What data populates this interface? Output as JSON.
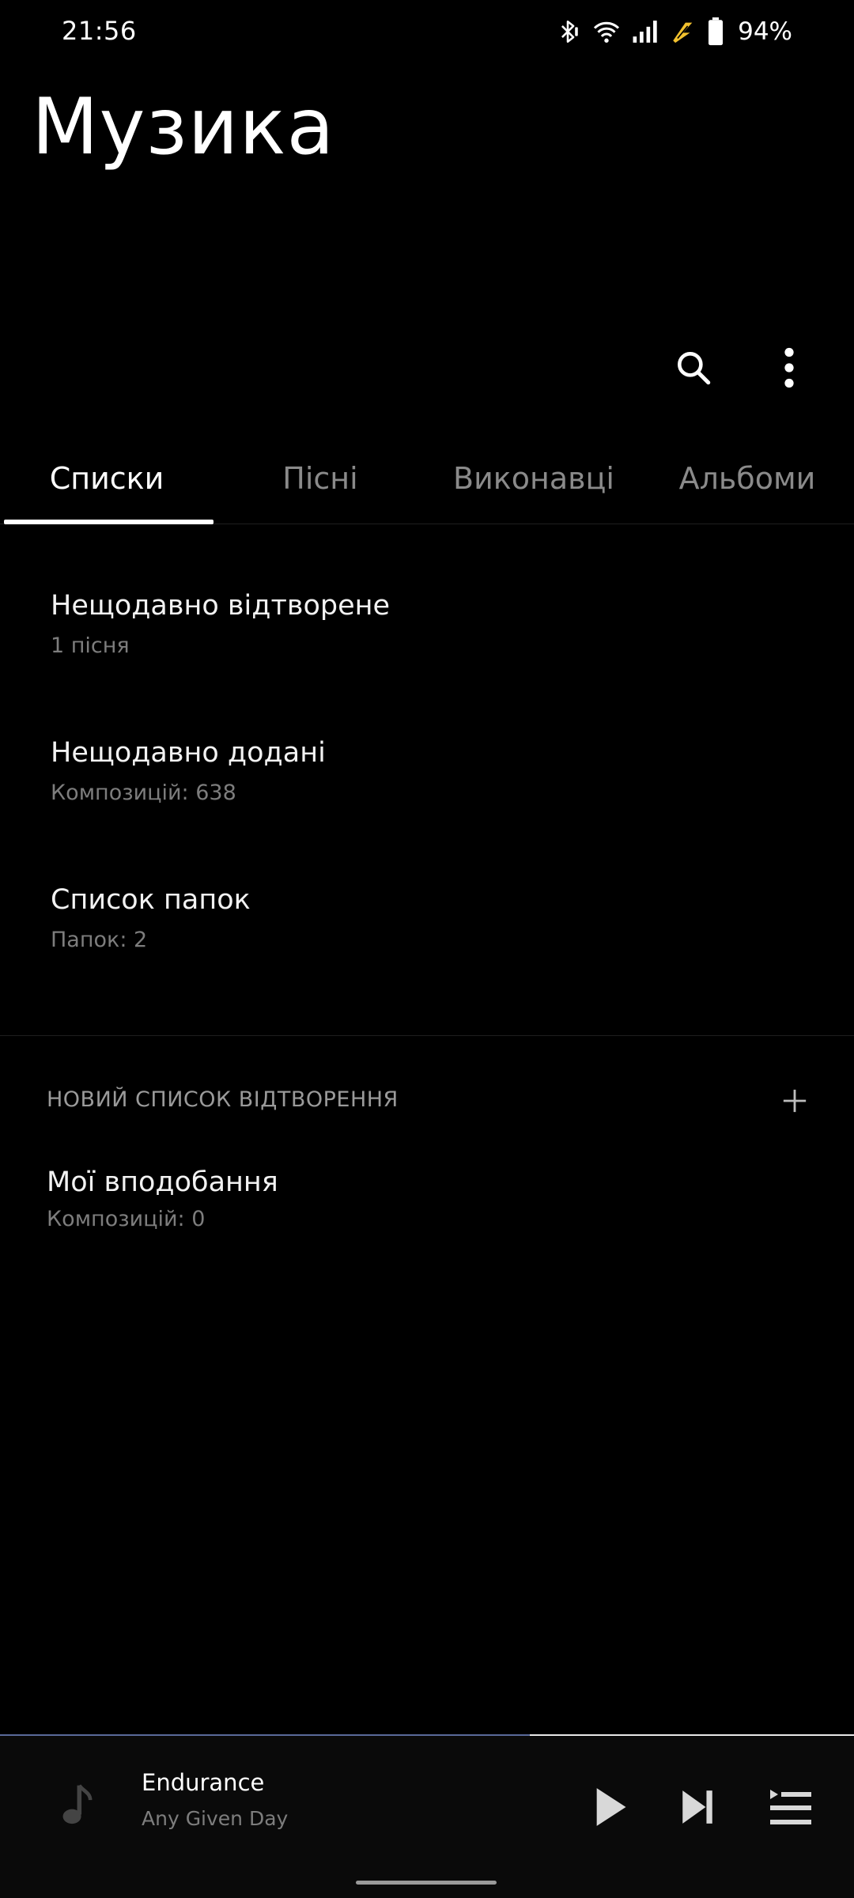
{
  "status_bar": {
    "time": "21:56",
    "battery_percent": "94%",
    "icons": [
      "bluetooth-icon",
      "wifi-icon",
      "signal-icon",
      "charging-icon",
      "battery-icon"
    ]
  },
  "app": {
    "title": "Музика"
  },
  "toolbar": {
    "icons": [
      "search-icon",
      "more-vert-icon"
    ]
  },
  "tabs": [
    {
      "label": "Списки",
      "active": true
    },
    {
      "label": "Пісні",
      "active": false
    },
    {
      "label": "Виконавці",
      "active": false
    },
    {
      "label": "Альбоми",
      "active": false
    }
  ],
  "lists": [
    {
      "title": "Нещодавно відтворене",
      "subtitle": "1 пісня"
    },
    {
      "title": "Нещодавно додані",
      "subtitle": "Композицій: 638"
    },
    {
      "title": "Список папок",
      "subtitle": "Папок: 2"
    }
  ],
  "playlists_section": {
    "header": "НОВИЙ СПИСОК ВІДТВОРЕННЯ",
    "items": [
      {
        "title": "Мої вподобання",
        "subtitle": "Композицій: 0"
      }
    ]
  },
  "player": {
    "title": "Endurance",
    "artist": "Any Given Day",
    "progress": 0.62,
    "colors": {
      "progress_fill": "#5a6a9a",
      "track": "#e8e8e8"
    }
  }
}
